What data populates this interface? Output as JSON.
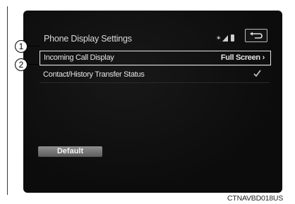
{
  "screen": {
    "title": "Phone Display Settings",
    "icons": {
      "status": [
        "bluetooth-icon",
        "signal-icon",
        "battery-icon"
      ],
      "back": "back-arrow-icon"
    }
  },
  "settings": [
    {
      "label": "Incoming Call Display",
      "value": "Full Screen",
      "selected": true
    },
    {
      "label": "Contact/History Transfer Status",
      "checked": true
    }
  ],
  "default_button": "Default",
  "callouts": [
    "1",
    "2"
  ],
  "figure_code": "CTNAVBD018US",
  "colors": {
    "screen_bg": "#0c0c0c",
    "text": "#e4e4e4",
    "button": "#7a7a7a"
  }
}
